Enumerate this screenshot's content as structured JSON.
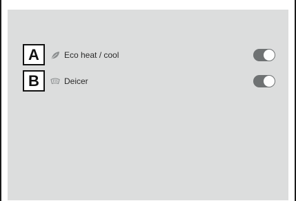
{
  "settings": {
    "items": [
      {
        "callout": "A",
        "icon": "leaf-icon",
        "label": "Eco heat / cool",
        "enabled": true
      },
      {
        "callout": "B",
        "icon": "windshield-deicer-icon",
        "label": "Deicer",
        "enabled": true
      }
    ]
  },
  "colors": {
    "screen_background": "#dcdddd",
    "toggle_track": "#6f7273",
    "toggle_knob": "#fdfdfd",
    "callout_border": "#111111"
  }
}
